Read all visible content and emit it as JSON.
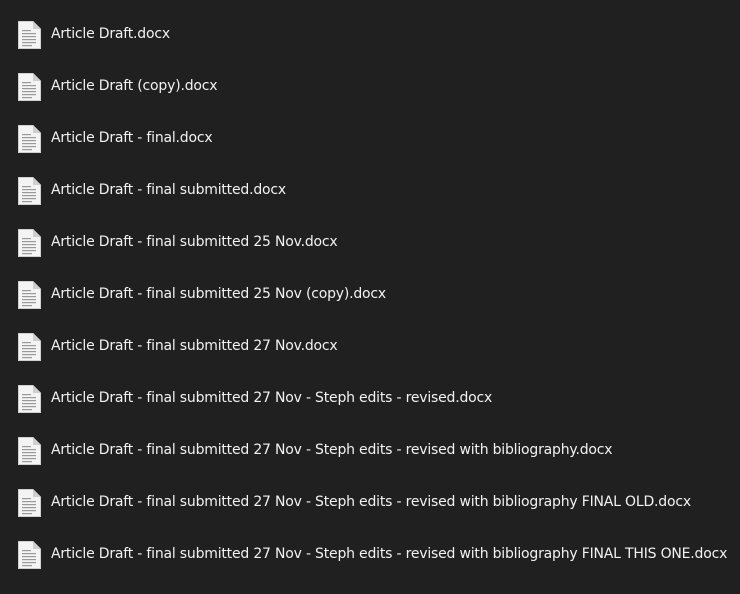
{
  "files": [
    {
      "name": "Article Draft.docx",
      "icon": "document-icon"
    },
    {
      "name": "Article Draft (copy).docx",
      "icon": "document-icon"
    },
    {
      "name": "Article Draft - final.docx",
      "icon": "document-icon"
    },
    {
      "name": "Article Draft - final submitted.docx",
      "icon": "document-icon"
    },
    {
      "name": "Article Draft - final submitted 25 Nov.docx",
      "icon": "document-icon"
    },
    {
      "name": "Article Draft - final submitted 25 Nov (copy).docx",
      "icon": "document-icon"
    },
    {
      "name": "Article Draft - final submitted 27 Nov.docx",
      "icon": "document-icon"
    },
    {
      "name": "Article Draft - final submitted 27 Nov - Steph edits - revised.docx",
      "icon": "document-icon"
    },
    {
      "name": "Article Draft - final submitted 27 Nov - Steph edits - revised with bibliography.docx",
      "icon": "document-icon"
    },
    {
      "name": "Article Draft - final submitted 27 Nov - Steph edits - revised with bibliography FINAL OLD.docx",
      "icon": "document-icon"
    },
    {
      "name": "Article Draft - final submitted 27 Nov - Steph edits - revised with bibliography FINAL THIS ONE.docx",
      "icon": "document-icon"
    }
  ],
  "colors": {
    "background": "#202020",
    "text": "#f2f2f2",
    "icon_page": "#f4f4f4",
    "icon_lines": "#9a9a9a"
  }
}
